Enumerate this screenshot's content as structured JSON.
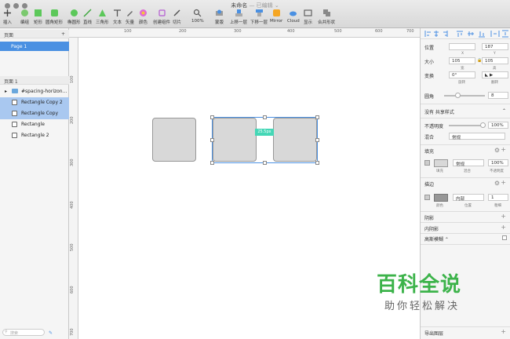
{
  "window": {
    "title": "未命名",
    "subtitle": "— 已编辑 ⌄"
  },
  "toolbar": [
    {
      "label": "插入"
    },
    {
      "label": "编组"
    },
    {
      "label": "矩形"
    },
    {
      "label": "圆角矩形"
    },
    {
      "label": "椭圆形"
    },
    {
      "label": "直线"
    },
    {
      "label": "三角形"
    },
    {
      "label": "文本"
    },
    {
      "label": "矢量"
    },
    {
      "label": "颜色"
    },
    {
      "label": "创建组件"
    },
    {
      "label": "切片"
    },
    {
      "label": "100%"
    },
    {
      "label": "蒙版"
    },
    {
      "label": "上移一层"
    },
    {
      "label": "下移一层"
    },
    {
      "label": "Mirror"
    },
    {
      "label": "Cloud"
    },
    {
      "label": "显示"
    },
    {
      "label": "合并形状"
    }
  ],
  "ruler_top": [
    "100",
    "200",
    "300",
    "400",
    "500",
    "600",
    "700"
  ],
  "ruler_left": [
    "100",
    "200",
    "300",
    "400",
    "500",
    "600",
    "700"
  ],
  "pages": {
    "header": "页面",
    "add": "+",
    "items": [
      {
        "label": "Page 1"
      }
    ]
  },
  "layers": {
    "header": "页面 1",
    "items": [
      {
        "label": "#spacing-horizon..."
      },
      {
        "label": "Rectangle Copy 2"
      },
      {
        "label": "Rectangle Copy"
      },
      {
        "label": "Rectangle"
      },
      {
        "label": "Rectangle 2"
      }
    ]
  },
  "search": {
    "placeholder": "搜索"
  },
  "measure": {
    "label": "25.5px"
  },
  "inspector": {
    "position": {
      "label": "位置",
      "x": "",
      "y": "187",
      "x_cap": "X",
      "y_cap": "Y"
    },
    "size": {
      "label": "大小",
      "w": "105",
      "h": "105",
      "w_cap": "宽",
      "h_cap": "高"
    },
    "transform": {
      "label": "变换",
      "rotate": "0°",
      "rotate_cap": "旋转",
      "flip_cap": "翻转"
    },
    "radius": {
      "label": "圆角",
      "value": "8"
    },
    "shared_style": {
      "label": "没有 共享样式"
    },
    "opacity": {
      "label": "不透明度",
      "value": "100%"
    },
    "blend": {
      "label": "混合",
      "value": "常规"
    },
    "fill": {
      "label": "填充",
      "blend": "常规",
      "opacity": "100%",
      "caps": [
        "填充",
        "混合",
        "不透明度"
      ]
    },
    "border": {
      "label": "描边",
      "position": "内部",
      "width": "1",
      "caps": [
        "颜色",
        "位置",
        "粗细"
      ]
    },
    "shadow": {
      "label": "阴影"
    },
    "inner_shadow": {
      "label": "内阴影"
    },
    "blur": {
      "label": "高斯模糊 ⌃"
    },
    "export": {
      "label": "导出图层"
    }
  },
  "watermark": {
    "line1": "百科全说",
    "line2": "助你轻松解决"
  },
  "colors": {
    "accent": "#4a90e2",
    "measure": "#44d7b6",
    "watermark": "#3cb34a"
  }
}
